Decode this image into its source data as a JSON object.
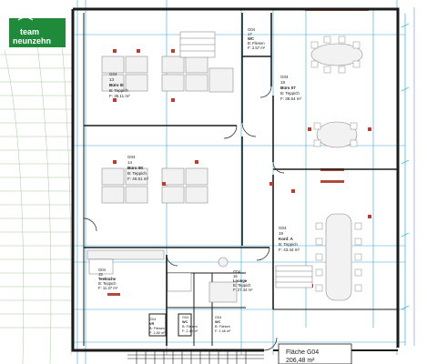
{
  "logo": {
    "line1": "team",
    "line2": "neunzehn",
    "bg_color": "#1f8a3a",
    "fg_color": "#ffffff"
  },
  "rooms": [
    {
      "code": "G04",
      "num": "13",
      "name": "Büro 0I",
      "floor": "B: Teppich",
      "area": "F: 36.11 m²"
    },
    {
      "code": "G04",
      "num": "17",
      "name": "WC",
      "floor": "B: Fliesen",
      "area": "F: 2.57 m²"
    },
    {
      "code": "G04",
      "num": "18",
      "name": "Büro 07",
      "floor": "B: Teppich",
      "area": "F: 38.64 m²"
    },
    {
      "code": "G04",
      "num": "14",
      "name": "Büro 0K",
      "floor": "B: Teppich",
      "area": "F: 40.61 m²"
    },
    {
      "code": "G04",
      "num": "19",
      "name": "Konf. A",
      "floor": "B: Teppich",
      "area": "F: 43.44 m²"
    },
    {
      "code": "G04",
      "num": "15",
      "name": "Teeküche",
      "floor": "B: Teppich",
      "area": "F: 11.37 m²"
    },
    {
      "code": "G04",
      "num": "16",
      "name": "Lounge",
      "floor": "B: Teppich",
      "area": "F: 27.34 m²"
    },
    {
      "code": "G04",
      "num": "",
      "name": "VR",
      "floor": "B: Fliesen",
      "area": "F: 1.80 m²"
    },
    {
      "code": "G04",
      "num": "",
      "name": "WC",
      "floor": "B: Fliesen",
      "area": "F: 2.45 m²"
    },
    {
      "code": "G04",
      "num": "",
      "name": "WC",
      "floor": "B: Fliesen",
      "area": "F: 2.46 m²"
    }
  ],
  "area_box": {
    "label": "Fläche G04",
    "value": "206,48 m²"
  },
  "colors": {
    "wall": "#1c1c1c",
    "grid": "#35a8d8",
    "dim": "#4bb8e0",
    "furniture": "#8c8c8c",
    "radiator": "#c0392b",
    "window_strip": "#b04a3a",
    "outside_hatch": "#a8c8a0"
  }
}
